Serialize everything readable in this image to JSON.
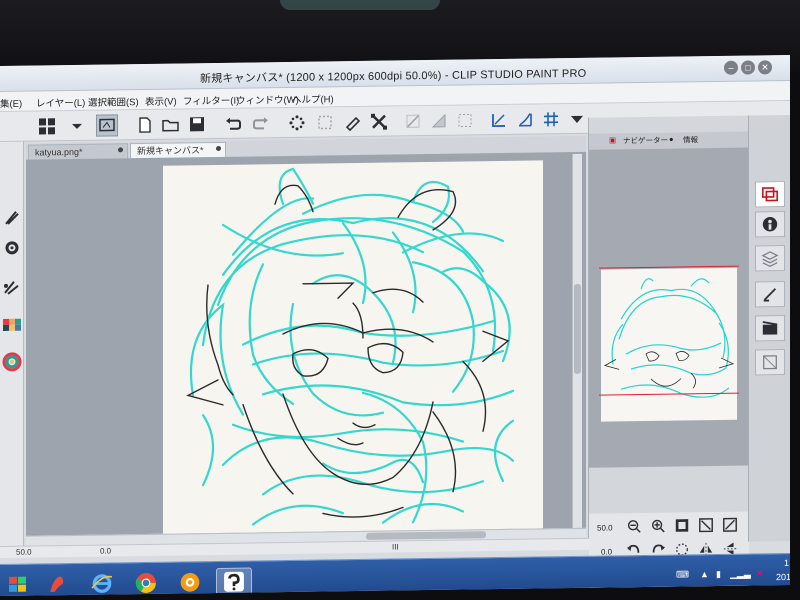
{
  "window": {
    "title": "新規キャンバス* (1200 x 1200px 600dpi 50.0%) - CLIP STUDIO PAINT PRO"
  },
  "menu": {
    "items": [
      "集(E)",
      "レイヤー(L)",
      "選択範囲(S)",
      "表示(V)",
      "フィルター(I)",
      "ウィンドウ(W)",
      "ヘルプ(H)"
    ]
  },
  "toolbar": {
    "icons": [
      "menu-grid-icon",
      "dropdown-icon",
      "quick-access-icon",
      "new-file-icon",
      "open-folder-icon",
      "save-icon",
      "undo-icon",
      "redo-icon",
      "clear-icon",
      "transform-icon",
      "fill-icon",
      "deselect-icon",
      "ruler-icon",
      "snap-icon",
      "grid-icon",
      "perspective-icon",
      "special-ruler-icon",
      "toolbar-menu-icon"
    ]
  },
  "tabs": [
    {
      "label": "katyua.png*",
      "active": false
    },
    {
      "label": "新規キャンバス*",
      "active": true
    }
  ],
  "navigator": {
    "tab_label": "ナビゲーター",
    "info_tab_label": "情報",
    "zoom_value": "50.0",
    "rotate_value": "0.0"
  },
  "status": {
    "zoom": "50.0",
    "angle": "0.0",
    "position": "III"
  },
  "canvas": {
    "line_color": "#24d5cc",
    "ink_color": "#222222"
  },
  "taskbar": {
    "time": "1",
    "date": "201",
    "apps": [
      "start-icon",
      "app-icon",
      "internet-explorer-icon",
      "chrome-icon",
      "firefox-icon",
      "clip-studio-icon"
    ]
  },
  "colors": {
    "accent": "#e0202a",
    "taskbar": "#2a55a0",
    "sketch": "#24d5cc"
  }
}
